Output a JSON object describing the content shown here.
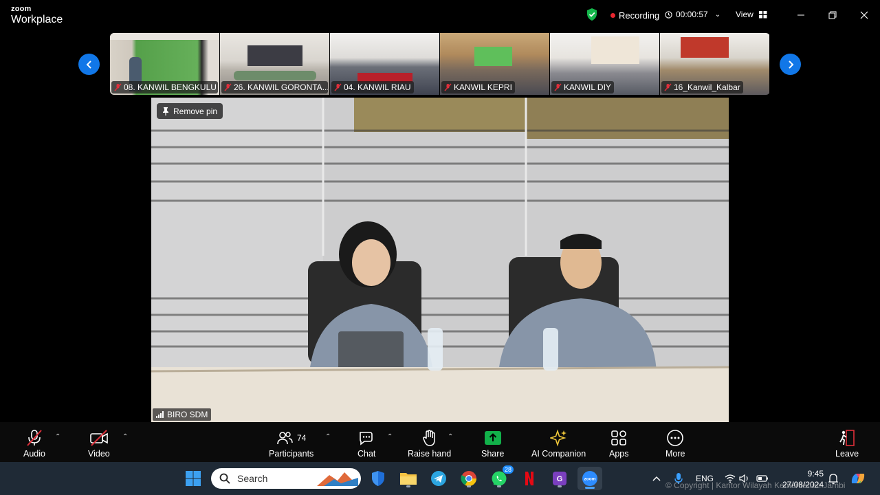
{
  "app": {
    "brand_small": "zoom",
    "brand_large": "Workplace"
  },
  "titlebar": {
    "recording_label": "Recording",
    "timer": "00:00:57",
    "view_label": "View"
  },
  "gallery": {
    "tiles": [
      {
        "name": "08. KANWIL BENGKULU",
        "muted": true
      },
      {
        "name": "26. KANWIL GORONTA...",
        "muted": true
      },
      {
        "name": "04. KANWIL RIAU",
        "muted": true
      },
      {
        "name": "KANWIL KEPRI",
        "muted": true
      },
      {
        "name": "KANWIL DIY",
        "muted": true
      },
      {
        "name": "16_Kanwil_Kalbar",
        "muted": true
      }
    ]
  },
  "main_video": {
    "pin_label": "Remove pin",
    "speaker_name": "BIRO SDM"
  },
  "toolbar": {
    "audio": "Audio",
    "video": "Video",
    "participants": "Participants",
    "participants_count": "74",
    "chat": "Chat",
    "raise_hand": "Raise hand",
    "share": "Share",
    "ai_companion": "AI Companion",
    "apps": "Apps",
    "more": "More",
    "leave": "Leave"
  },
  "taskbar": {
    "search_placeholder": "Search",
    "whatsapp_badge": "28",
    "language": "ENG",
    "time": "9:45",
    "date": "27/08/2024"
  },
  "watermark": "© Copyright | Kantor Wilayah Kementerian Jambi",
  "colors": {
    "accent_blue": "#1177e8",
    "share_green": "#12b14a",
    "record_red": "#e8262f",
    "mute_red": "#e02f3a"
  }
}
